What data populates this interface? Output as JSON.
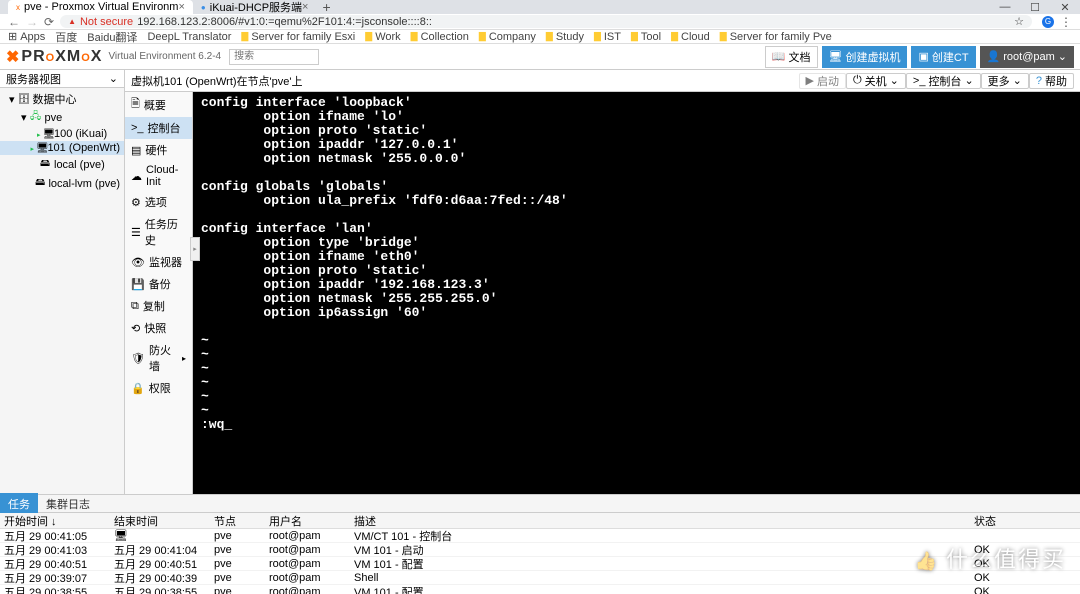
{
  "window": {
    "tab1_icon": "x",
    "tab1": "pve - Proxmox Virtual Environm",
    "tab2_icon": "●",
    "tab2": "iKuai-DHCP服务端",
    "min": "—",
    "max": "☐",
    "close": "✕"
  },
  "toolbar": {
    "back": "←",
    "fwd": "→",
    "reload": "⟳",
    "notsecure": "Not secure",
    "url": "192.168.123.2:8006/#v1:0:=qemu%2F101:4:=jsconsole::::8::",
    "star": "☆",
    "avatar": "G"
  },
  "bookmarks": {
    "apps": "Apps",
    "items": [
      "百度",
      "Baidu翻译",
      "DeepL Translator",
      "Work",
      "Collection",
      "Company",
      "Study",
      "IST",
      "Tool",
      "Cloud",
      "Server for family Pve"
    ],
    "first": "Server for family Esxi"
  },
  "pve": {
    "logo": "PROXMOX",
    "ver": "Virtual Environment 6.2-4",
    "search_ph": "搜索",
    "btn_doc": "文档",
    "btn_vm": "创建虚拟机",
    "btn_ct": "创建CT",
    "btn_user": "root@pam"
  },
  "tree": {
    "hdr": "服务器视图",
    "arrow": "⌄",
    "dc": "数据中心",
    "pve": "pve",
    "vm100": "100 (iKuai)",
    "vm101": "101 (OpenWrt)",
    "local": "local (pve)",
    "locallvm": "local-lvm (pve)"
  },
  "vmhdr": {
    "title": "虚拟机101 (OpenWrt)在节点'pve'上",
    "start": "启动",
    "shutdown": "关机",
    "console": "控制台",
    "more": "更多",
    "help": "帮助"
  },
  "vmmenu": {
    "summary": "概要",
    "console": "控制台",
    "hardware": "硬件",
    "cloudinit": "Cloud-Init",
    "options": "选项",
    "taskhist": "任务历史",
    "monitor": "监视器",
    "backup": "备份",
    "replication": "复制",
    "snapshot": "快照",
    "firewall": "防火墙",
    "perm": "权限",
    "toggle": "▸"
  },
  "console_text": "config interface 'loopback'\n        option ifname 'lo'\n        option proto 'static'\n        option ipaddr '127.0.0.1'\n        option netmask '255.0.0.0'\n\nconfig globals 'globals'\n        option ula_prefix 'fdf0:d6aa:7fed::/48'\n\nconfig interface 'lan'\n        option type 'bridge'\n        option ifname 'eth0'\n        option proto 'static'\n        option ipaddr '192.168.123.3'\n        option netmask '255.255.255.0'\n        option ip6assign '60'\n\n~\n~\n~\n~\n~\n~\n:wq_",
  "tasks": {
    "tab1": "任务",
    "tab2": "集群日志",
    "hdr": {
      "start": "开始时间 ↓",
      "end": "结束时间",
      "node": "节点",
      "user": "用户名",
      "desc": "描述",
      "status": "状态"
    },
    "rows": [
      {
        "start": "五月 29 00:41:05",
        "end": "",
        "end_icon": "🖥",
        "node": "pve",
        "user": "root@pam",
        "desc": "VM/CT 101 - 控制台",
        "status": ""
      },
      {
        "start": "五月 29 00:41:03",
        "end": "五月 29 00:41:04",
        "node": "pve",
        "user": "root@pam",
        "desc": "VM 101 - 启动",
        "status": "OK"
      },
      {
        "start": "五月 29 00:40:51",
        "end": "五月 29 00:40:51",
        "node": "pve",
        "user": "root@pam",
        "desc": "VM 101 - 配置",
        "status": "OK"
      },
      {
        "start": "五月 29 00:39:07",
        "end": "五月 29 00:40:39",
        "node": "pve",
        "user": "root@pam",
        "desc": "Shell",
        "status": "OK"
      },
      {
        "start": "五月 29 00:38:55",
        "end": "五月 29 00:38:55",
        "node": "pve",
        "user": "root@pam",
        "desc": "VM 101 - 配置",
        "status": "OK"
      }
    ]
  },
  "watermark": "什么值得买"
}
